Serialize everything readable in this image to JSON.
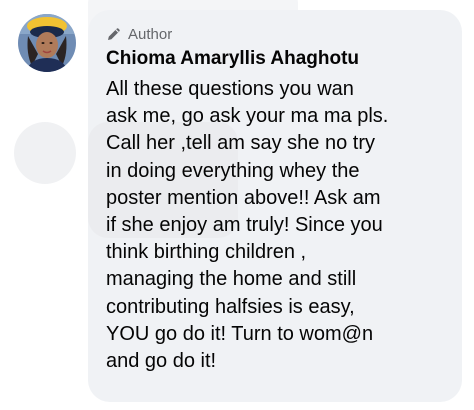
{
  "comment": {
    "author_badge": "Author",
    "author_badge_icon": "pencil-icon",
    "author_name": "Chioma Amaryllis Ahaghotu",
    "text_lines": [
      "All these questions you wan",
      "ask me, go ask your ma ma pls.",
      "Call her ,tell am say she no try",
      "in doing everything whey the",
      "poster mention above!! Ask am",
      "if she enjoy am truly! Since you",
      "think birthing children ,",
      "managing the home and still",
      "contributing halfsies is easy,",
      "YOU go do it! Turn to wom@n",
      "and go do it!"
    ]
  },
  "colors": {
    "bubble_background": "#f0f2f5",
    "text": "#050505",
    "secondary_text": "#65676b"
  }
}
